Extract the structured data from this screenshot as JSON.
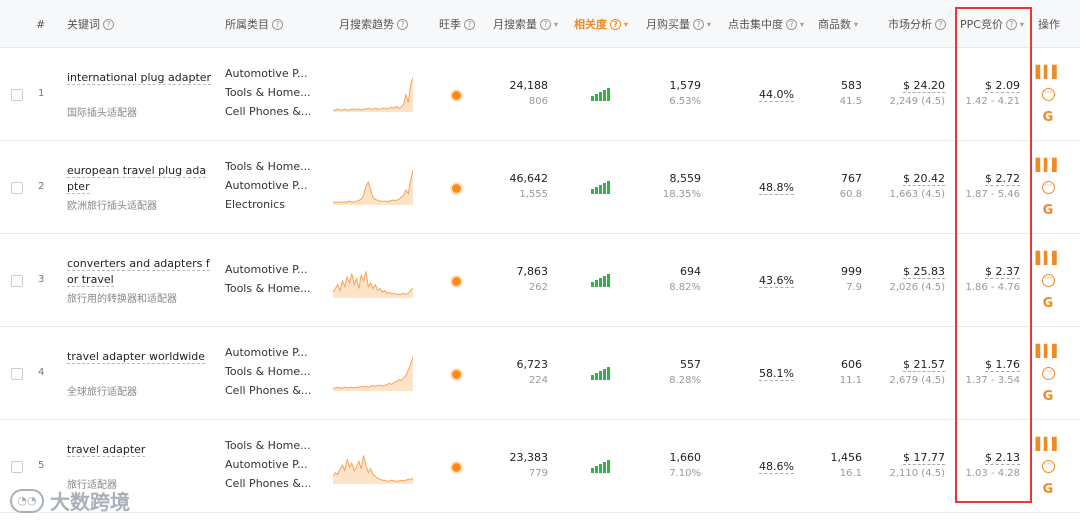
{
  "header": {
    "idx": "#",
    "keyword": "关键词",
    "category": "所属类目",
    "trend": "月搜索趋势",
    "wangshou": "旺季",
    "search_volume": "月搜索量",
    "relevance": "相关度",
    "purchase": "月购买量",
    "click_concentration": "点击集中度",
    "products": "商品数",
    "market": "市场分析",
    "ppc": "PPC竞价",
    "ops": "操作"
  },
  "colors": {
    "accent": "#f08a24",
    "green": "#34b24a",
    "highlight_box": "#e53935"
  },
  "rows": [
    {
      "index": "1",
      "keyword": "international plug adapter",
      "keyword_zh": "国际插头适配器",
      "categories": [
        "Automotive P...",
        "Tools & Home...",
        "Cell Phones &..."
      ],
      "trend": [
        2,
        2,
        3,
        2,
        2,
        3,
        2,
        2,
        3,
        3,
        2,
        3,
        2,
        3,
        3,
        4,
        3,
        3,
        4,
        3,
        3,
        4,
        4,
        3,
        4,
        5,
        4,
        6,
        4,
        5,
        8,
        18,
        10,
        28,
        36
      ],
      "search_volume": "24,188",
      "search_sub": "806",
      "relevance_level": 5,
      "purchase": "1,579",
      "purchase_pct": "6.53%",
      "click_concentration": "44.0%",
      "products": "583",
      "products_sub": "41.5",
      "market_price": "$ 24.20",
      "market_sub": "2,249 (4.5)",
      "ppc": "$ 2.09",
      "ppc_range": "1.42 - 4.21"
    },
    {
      "index": "2",
      "keyword": "european travel plug adapter",
      "keyword_zh": "欧洲旅行插头适配器",
      "categories": [
        "Tools & Home...",
        "Automotive P...",
        "Electronics"
      ],
      "trend": [
        3,
        3,
        3,
        3,
        3,
        3,
        3,
        4,
        3,
        3,
        4,
        5,
        6,
        10,
        20,
        24,
        16,
        8,
        6,
        5,
        4,
        4,
        4,
        4,
        4,
        5,
        5,
        5,
        6,
        8,
        10,
        16,
        12,
        26,
        36
      ],
      "search_volume": "46,642",
      "search_sub": "1,555",
      "relevance_level": 5,
      "purchase": "8,559",
      "purchase_pct": "18.35%",
      "click_concentration": "48.8%",
      "products": "767",
      "products_sub": "60.8",
      "market_price": "$ 20.42",
      "market_sub": "1,663 (4.5)",
      "ppc": "$ 2.72",
      "ppc_range": "1.87 - 5.46"
    },
    {
      "index": "3",
      "keyword": "converters and adapters for travel",
      "keyword_zh": "旅行用的转换器和适配器",
      "categories": [
        "Automotive P...",
        "Tools & Home..."
      ],
      "trend": [
        6,
        10,
        14,
        8,
        18,
        12,
        22,
        16,
        26,
        14,
        20,
        10,
        24,
        18,
        28,
        12,
        16,
        10,
        14,
        8,
        10,
        6,
        8,
        5,
        6,
        4,
        5,
        4,
        4,
        4,
        5,
        4,
        5,
        8,
        10
      ],
      "search_volume": "7,863",
      "search_sub": "262",
      "relevance_level": 5,
      "purchase": "694",
      "purchase_pct": "8.82%",
      "click_concentration": "43.6%",
      "products": "999",
      "products_sub": "7.9",
      "market_price": "$ 25.83",
      "market_sub": "2,026 (4.5)",
      "ppc": "$ 2.37",
      "ppc_range": "1.86 - 4.76"
    },
    {
      "index": "4",
      "keyword": "travel adapter worldwide",
      "keyword_zh": "全球旅行适配器",
      "categories": [
        "Automotive P...",
        "Tools & Home...",
        "Cell Phones &..."
      ],
      "trend": [
        3,
        3,
        4,
        3,
        3,
        4,
        3,
        4,
        4,
        3,
        4,
        4,
        5,
        4,
        5,
        4,
        5,
        6,
        5,
        6,
        6,
        5,
        6,
        7,
        8,
        7,
        9,
        10,
        12,
        11,
        14,
        16,
        22,
        28,
        36
      ],
      "search_volume": "6,723",
      "search_sub": "224",
      "relevance_level": 5,
      "purchase": "557",
      "purchase_pct": "8.28%",
      "click_concentration": "58.1%",
      "products": "606",
      "products_sub": "11.1",
      "market_price": "$ 21.57",
      "market_sub": "2,679 (4.5)",
      "ppc": "$ 1.76",
      "ppc_range": "1.37 - 3.54"
    },
    {
      "index": "5",
      "keyword": "travel adapter",
      "keyword_zh": "旅行适配器",
      "categories": [
        "Tools & Home...",
        "Automotive P...",
        "Cell Phones &..."
      ],
      "trend": [
        8,
        12,
        10,
        16,
        20,
        14,
        26,
        18,
        22,
        14,
        18,
        24,
        16,
        30,
        20,
        12,
        16,
        10,
        8,
        6,
        5,
        4,
        4,
        3,
        3,
        4,
        3,
        3,
        3,
        4,
        3,
        4,
        5,
        5,
        6
      ],
      "search_volume": "23,383",
      "search_sub": "779",
      "relevance_level": 5,
      "purchase": "1,660",
      "purchase_pct": "7.10%",
      "click_concentration": "48.6%",
      "products": "1,456",
      "products_sub": "16.1",
      "market_price": "$ 17.77",
      "market_sub": "2,110 (4.5)",
      "ppc": "$ 2.13",
      "ppc_range": "1.03 - 4.28"
    }
  ],
  "watermark": {
    "text": "大数跨境"
  }
}
